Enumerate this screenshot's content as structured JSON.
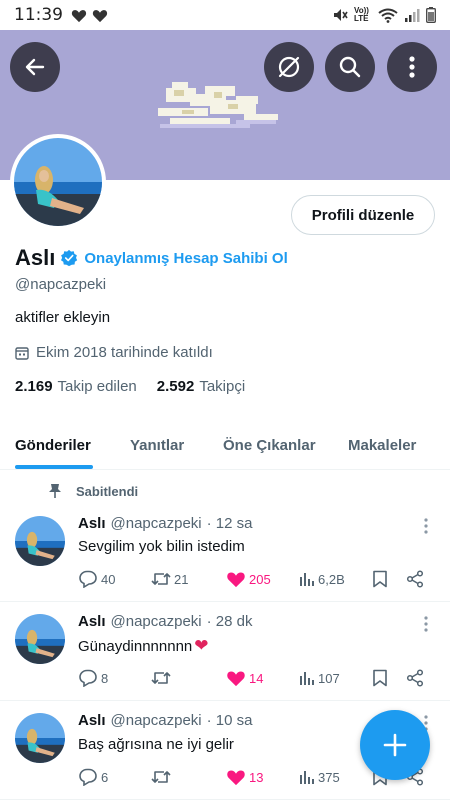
{
  "status_bar": {
    "time": "11:39",
    "network": "Vo)) LTE"
  },
  "profile": {
    "display_name": "Aslı",
    "verify_link": "Onaylanmış Hesap Sahibi Ol",
    "handle": "@napcazpeki",
    "bio": "aktifler ekleyin",
    "joined": "Ekim 2018 tarihinde katıldı",
    "following_count": "2.169",
    "following_label": "Takip edilen",
    "followers_count": "2.592",
    "followers_label": "Takipçi",
    "edit_button": "Profili düzenle"
  },
  "tabs": [
    {
      "label": "Gönderiler",
      "active": true
    },
    {
      "label": "Yanıtlar",
      "active": false
    },
    {
      "label": "Öne Çıkanlar",
      "active": false
    },
    {
      "label": "Makaleler",
      "active": false
    }
  ],
  "pinned_label": "Sabitlendi",
  "tweets": [
    {
      "author": "Aslı",
      "handle": "@napcazpeki",
      "time": "· 12 sa",
      "text": "Sevgilim yok bilin istedim",
      "emoji": "",
      "replies": "40",
      "retweets": "21",
      "likes": "205",
      "views": "6,2B"
    },
    {
      "author": "Aslı",
      "handle": "@napcazpeki",
      "time": "· 28 dk",
      "text": "Günaydinnnnnnn",
      "emoji": "❤",
      "replies": "8",
      "retweets": "",
      "likes": "14",
      "views": "107"
    },
    {
      "author": "Aslı",
      "handle": "@napcazpeki",
      "time": "· 10 sa",
      "text": "Baş ağrısına ne iyi gelir",
      "emoji": "",
      "replies": "6",
      "retweets": "",
      "likes": "13",
      "views": "375"
    }
  ],
  "colors": {
    "accent": "#1d9bf0",
    "like": "#f91880",
    "banner": "#a8a6d4",
    "secondary_text": "#536471"
  },
  "icons": [
    "back-arrow-icon",
    "translate-icon",
    "search-icon",
    "more-vertical-icon",
    "verified-badge-icon",
    "calendar-icon",
    "pin-icon",
    "reply-icon",
    "retweet-icon",
    "heart-icon",
    "views-icon",
    "bookmark-icon",
    "share-icon",
    "plus-icon"
  ]
}
